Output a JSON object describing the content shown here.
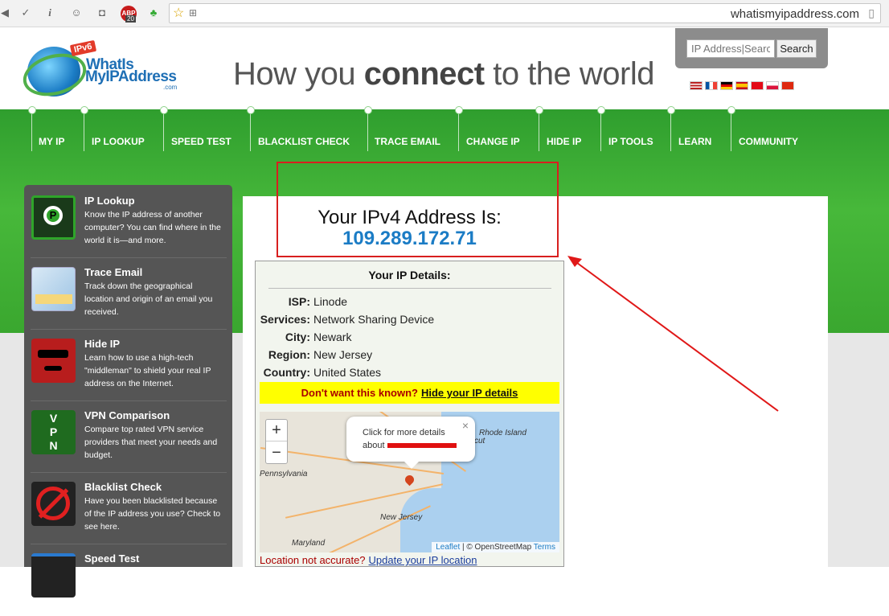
{
  "browser": {
    "url": "whatismyipaddress.com",
    "abp_label": "ABP",
    "abp_count": "20"
  },
  "header": {
    "badge": "IPv6",
    "logo_line1": "WhatIs",
    "logo_line2": "MyIPAddress",
    "logo_com": ".com",
    "tagline_pre": "How you ",
    "tagline_bold": "connect",
    "tagline_post": " to the world",
    "search_placeholder": "IP Address|Search",
    "search_button": "Search",
    "flags": [
      "us-flag",
      "fr-flag",
      "de-flag",
      "es-flag",
      "tr-flag",
      "pl-flag",
      "cn-flag"
    ]
  },
  "nav": [
    "MY IP",
    "IP LOOKUP",
    "SPEED TEST",
    "BLACKLIST CHECK",
    "TRACE EMAIL",
    "CHANGE IP",
    "HIDE IP",
    "IP TOOLS",
    "LEARN",
    "COMMUNITY"
  ],
  "sidebar": [
    {
      "title": "IP Lookup",
      "desc": "Know the IP address of another computer? You can find where in the world it is—and more.",
      "icon": "magnifier-icon"
    },
    {
      "title": "Trace Email",
      "desc": "Track down the geographical location and origin of an email you received.",
      "icon": "map-icon"
    },
    {
      "title": "Hide IP",
      "desc": "Learn how to use a high-tech \"middleman\" to shield your real IP address on the Internet.",
      "icon": "disguise-icon"
    },
    {
      "title": "VPN Comparison",
      "desc": "Compare top rated VPN service providers that meet your needs and budget.",
      "icon": "vpn-lock-icon"
    },
    {
      "title": "Blacklist Check",
      "desc": "Have you been blacklisted because of the IP address you use? Check to see here.",
      "icon": "no-ip-icon"
    },
    {
      "title": "Speed Test",
      "desc": "",
      "icon": "speedometer-icon"
    }
  ],
  "main": {
    "ipv4_label": "Your IPv4 Address Is:",
    "ip": "109.289.172.71",
    "details_title": "Your IP Details:",
    "details": [
      {
        "key": "ISP:",
        "value": "Linode"
      },
      {
        "key": "Services:",
        "value": "Network Sharing Device"
      },
      {
        "key": "City:",
        "value": "Newark"
      },
      {
        "key": "Region:",
        "value": "New Jersey"
      },
      {
        "key": "Country:",
        "value": "United States"
      }
    ],
    "warn_text": "Don't want this known?",
    "warn_link": "Hide your IP details",
    "map": {
      "popup_line1": "Click for more details",
      "popup_line2": "about",
      "labels": [
        "Pennsylvania",
        "New Jersey",
        "Maryland",
        "Rhode Island",
        "ticut"
      ],
      "zoom_in": "+",
      "zoom_out": "−",
      "attrib_leaflet": "Leaflet",
      "attrib_osm": "| © OpenStreetMap",
      "attrib_terms": "Terms"
    },
    "location_text": "Location not accurate?",
    "location_link": "Update your IP location"
  }
}
